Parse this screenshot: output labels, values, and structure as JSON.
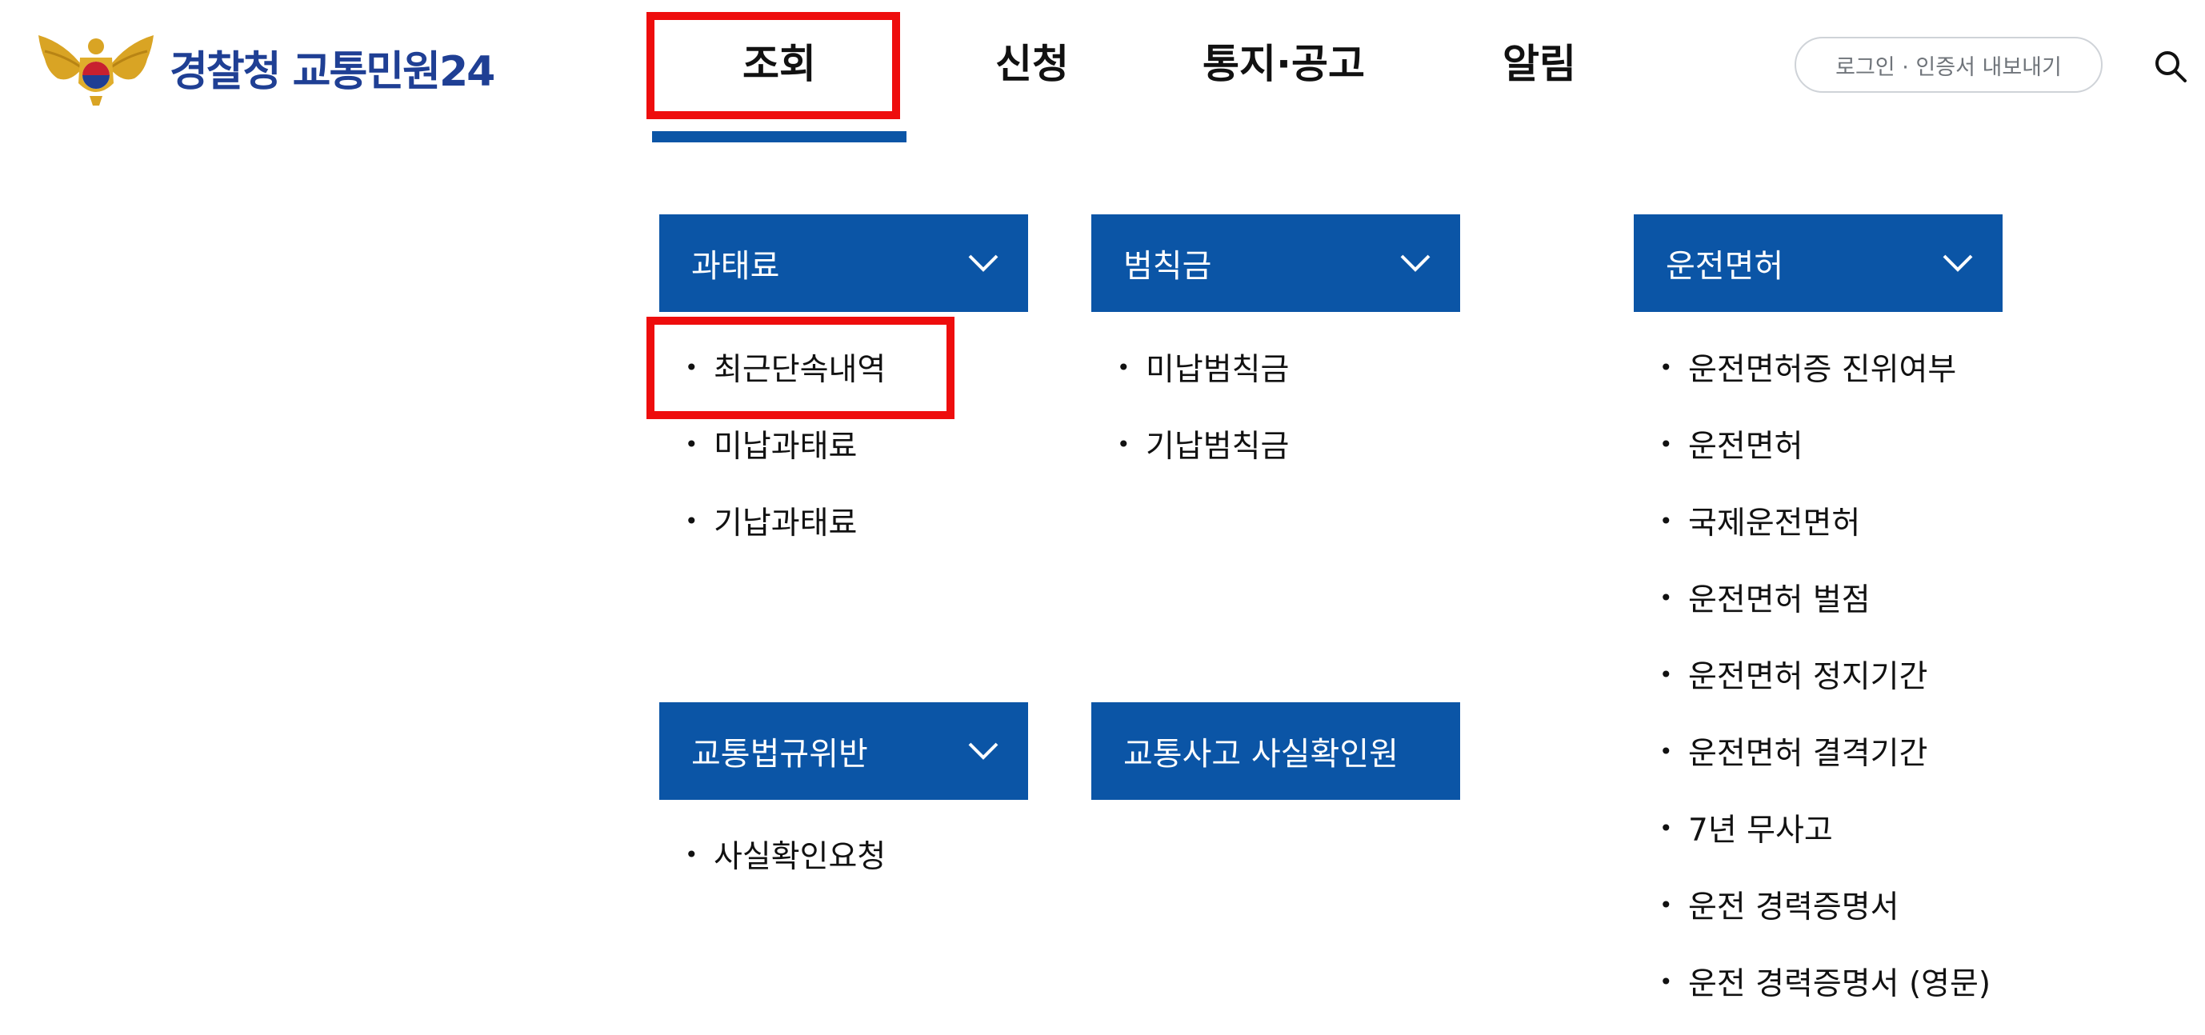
{
  "header": {
    "logo_text": "경찰청 교통민원24",
    "nav": [
      "조회",
      "신청",
      "통지·공고",
      "알림"
    ],
    "login_label": "로그인 · 인증서 내보내기"
  },
  "menu": {
    "categories": [
      {
        "title": "과태료",
        "items": [
          "최근단속내역",
          "미납과태료",
          "기납과태료"
        ]
      },
      {
        "title": "범칙금",
        "items": [
          "미납범칙금",
          "기납범칙금"
        ]
      },
      {
        "title": "운전면허",
        "items": [
          "운전면허증 진위여부",
          "운전면허",
          "국제운전면허",
          "운전면허 벌점",
          "운전면허 정지기간",
          "운전면허 결격기간",
          "7년 무사고",
          "운전 경력증명서",
          "운전 경력증명서 (영문)"
        ]
      },
      {
        "title": "교통법규위반",
        "items": [
          "사실확인요청"
        ]
      },
      {
        "title": "교통사고 사실확인원",
        "items": []
      }
    ]
  },
  "colors": {
    "primary": "#0b55a6",
    "highlight": "#ee0d0d",
    "logo_text": "#1f3f94"
  },
  "icons": {
    "search": "search-icon",
    "chevron": "chevron-down-icon",
    "emblem": "police-emblem-icon"
  }
}
